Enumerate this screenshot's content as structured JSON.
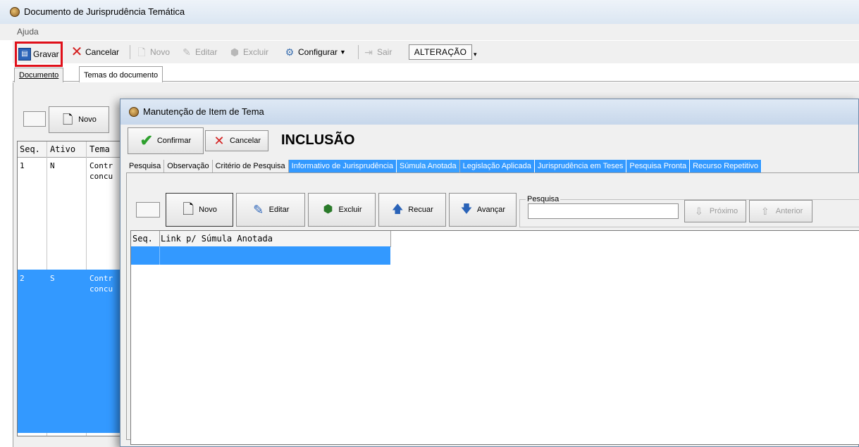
{
  "main_window": {
    "title": "Documento de Jurisprudência Temática",
    "menu": [
      "Ajuda"
    ],
    "toolbar": {
      "gravar": "Gravar",
      "cancelar": "Cancelar",
      "novo": "Novo",
      "editar": "Editar",
      "excluir": "Excluir",
      "configurar": "Configurar",
      "sair": "Sair",
      "mode": "ALTERAÇÃO"
    },
    "tabs": [
      "Documento",
      "Temas do documento"
    ],
    "panel_novo": "Novo",
    "grid": {
      "headers": [
        "Seq.",
        "Ativo",
        "Tema"
      ],
      "rows": [
        {
          "seq": "1",
          "ativo": "N",
          "tema_l1": "Contr",
          "tema_l2": "concu"
        },
        {
          "seq": "2",
          "ativo": "S",
          "tema_l1": "Contr",
          "tema_l2": "concu"
        }
      ]
    }
  },
  "dialog": {
    "title": "Manutenção de Item de Tema",
    "confirmar": "Confirmar",
    "cancelar": "Cancelar",
    "mode": "INCLUSÃO",
    "tabs": [
      "Pesquisa",
      "Observação",
      "Critério de Pesquisa",
      "Informativo de Jurisprudência",
      "Súmula Anotada",
      "Legislação Aplicada",
      "Jurisprudência em Teses",
      "Pesquisa Pronta",
      "Recurso Repetitivo"
    ],
    "buttons": {
      "novo": "Novo",
      "editar": "Editar",
      "excluir": "Excluir",
      "recuar": "Recuar",
      "avancar": "Avançar",
      "proximo": "Próximo",
      "anterior": "Anterior"
    },
    "search_label": "Pesquisa",
    "grid_headers": [
      "Seq.",
      "Link p/ Súmula Anotada"
    ]
  },
  "colors": {
    "highlight": "#3399ff",
    "annotation_red": "#e0101a"
  }
}
